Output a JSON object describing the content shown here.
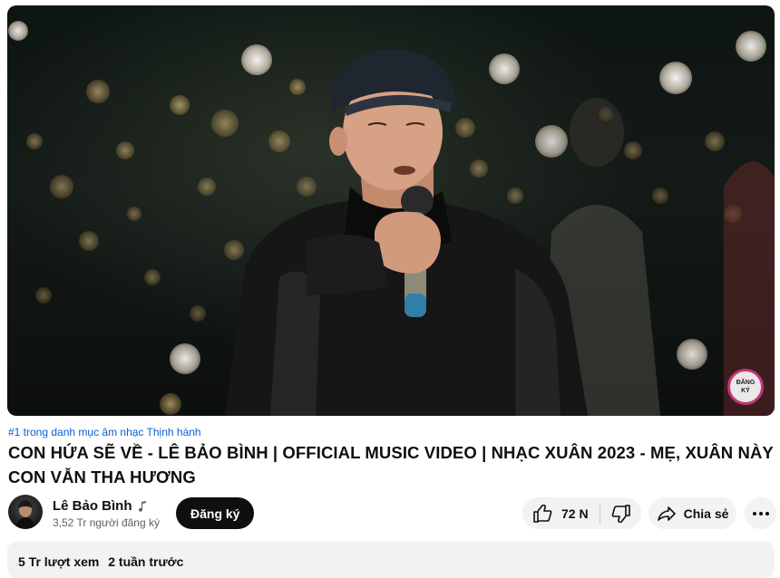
{
  "video": {
    "watermark_line1": "ĐĂNG",
    "watermark_line2": "KÝ"
  },
  "trending_label": "#1 trong danh mục âm nhạc Thịnh hành",
  "title": "CON HỨA SẼ VỀ - LÊ BẢO BÌNH | OFFICIAL MUSIC VIDEO | NHẠC XUÂN 2023 - MẸ, XUÂN NÀY CON VẪN THA HƯƠNG",
  "channel": {
    "name": "Lê Bảo Bình",
    "subscribers": "3,52 Tr người đăng ký",
    "subscribe_label": "Đăng ký",
    "verified_icon": "music-note-icon"
  },
  "actions": {
    "like_count": "72 N",
    "share_label": "Chia sẻ"
  },
  "description": {
    "views": "5 Tr lượt xem",
    "age": "2 tuần trước"
  },
  "colors": {
    "link": "#065fd4",
    "subscribe_bg": "#0f0f0f",
    "pill_bg": "#f2f2f2",
    "watermark_ring": "#c2357a"
  }
}
